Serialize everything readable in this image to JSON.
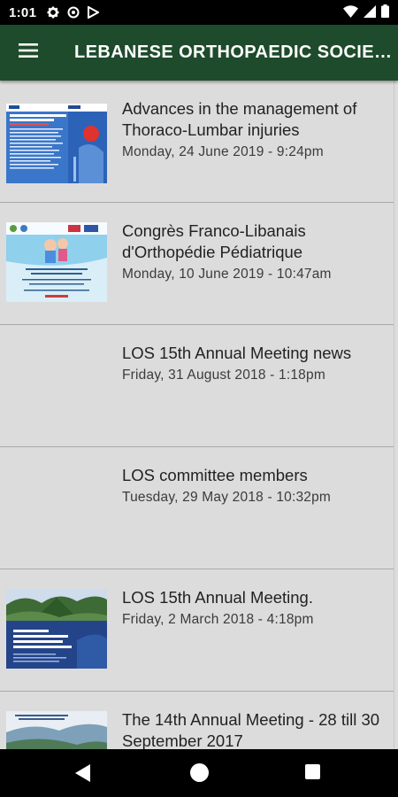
{
  "status_bar": {
    "time": "1:01",
    "left_icons": [
      "gear-icon",
      "circle-slash-icon",
      "play-store-icon"
    ],
    "right_icons": [
      "wifi-icon",
      "signal-icon",
      "battery-icon"
    ]
  },
  "app_bar": {
    "menu_icon": "hamburger-menu-icon",
    "title": "LEBANESE ORTHOPAEDIC SOCIETY"
  },
  "posts": [
    {
      "title": "Advances in the management of Thoraco-Lumbar injuries",
      "date": "Monday, 24 June 2019 - 9:24pm",
      "has_thumbnail": true
    },
    {
      "title": "Congrès Franco-Libanais d'Orthopédie Pédiatrique",
      "date": "Monday, 10 June 2019 - 10:47am",
      "has_thumbnail": true
    },
    {
      "title": "LOS 15th Annual Meeting news",
      "date": "Friday, 31 August 2018 - 1:18pm",
      "has_thumbnail": false
    },
    {
      "title": "LOS committee members",
      "date": "Tuesday, 29 May 2018 - 10:32pm",
      "has_thumbnail": false
    },
    {
      "title": "LOS 15th Annual Meeting.",
      "date": "Friday, 2 March 2018 - 4:18pm",
      "has_thumbnail": true
    },
    {
      "title": "The 14th Annual Meeting - 28 till 30 September 2017",
      "date": "",
      "has_thumbnail": true
    }
  ],
  "nav_bar": {
    "back_icon": "back-triangle-icon",
    "home_icon": "home-circle-icon",
    "recents_icon": "recents-square-icon"
  },
  "colors": {
    "app_bar": "#1e4b2b",
    "list_background": "#dcdcdc",
    "divider": "#a9a9a9",
    "title_text": "#222222",
    "date_text": "#3b3b3b"
  }
}
